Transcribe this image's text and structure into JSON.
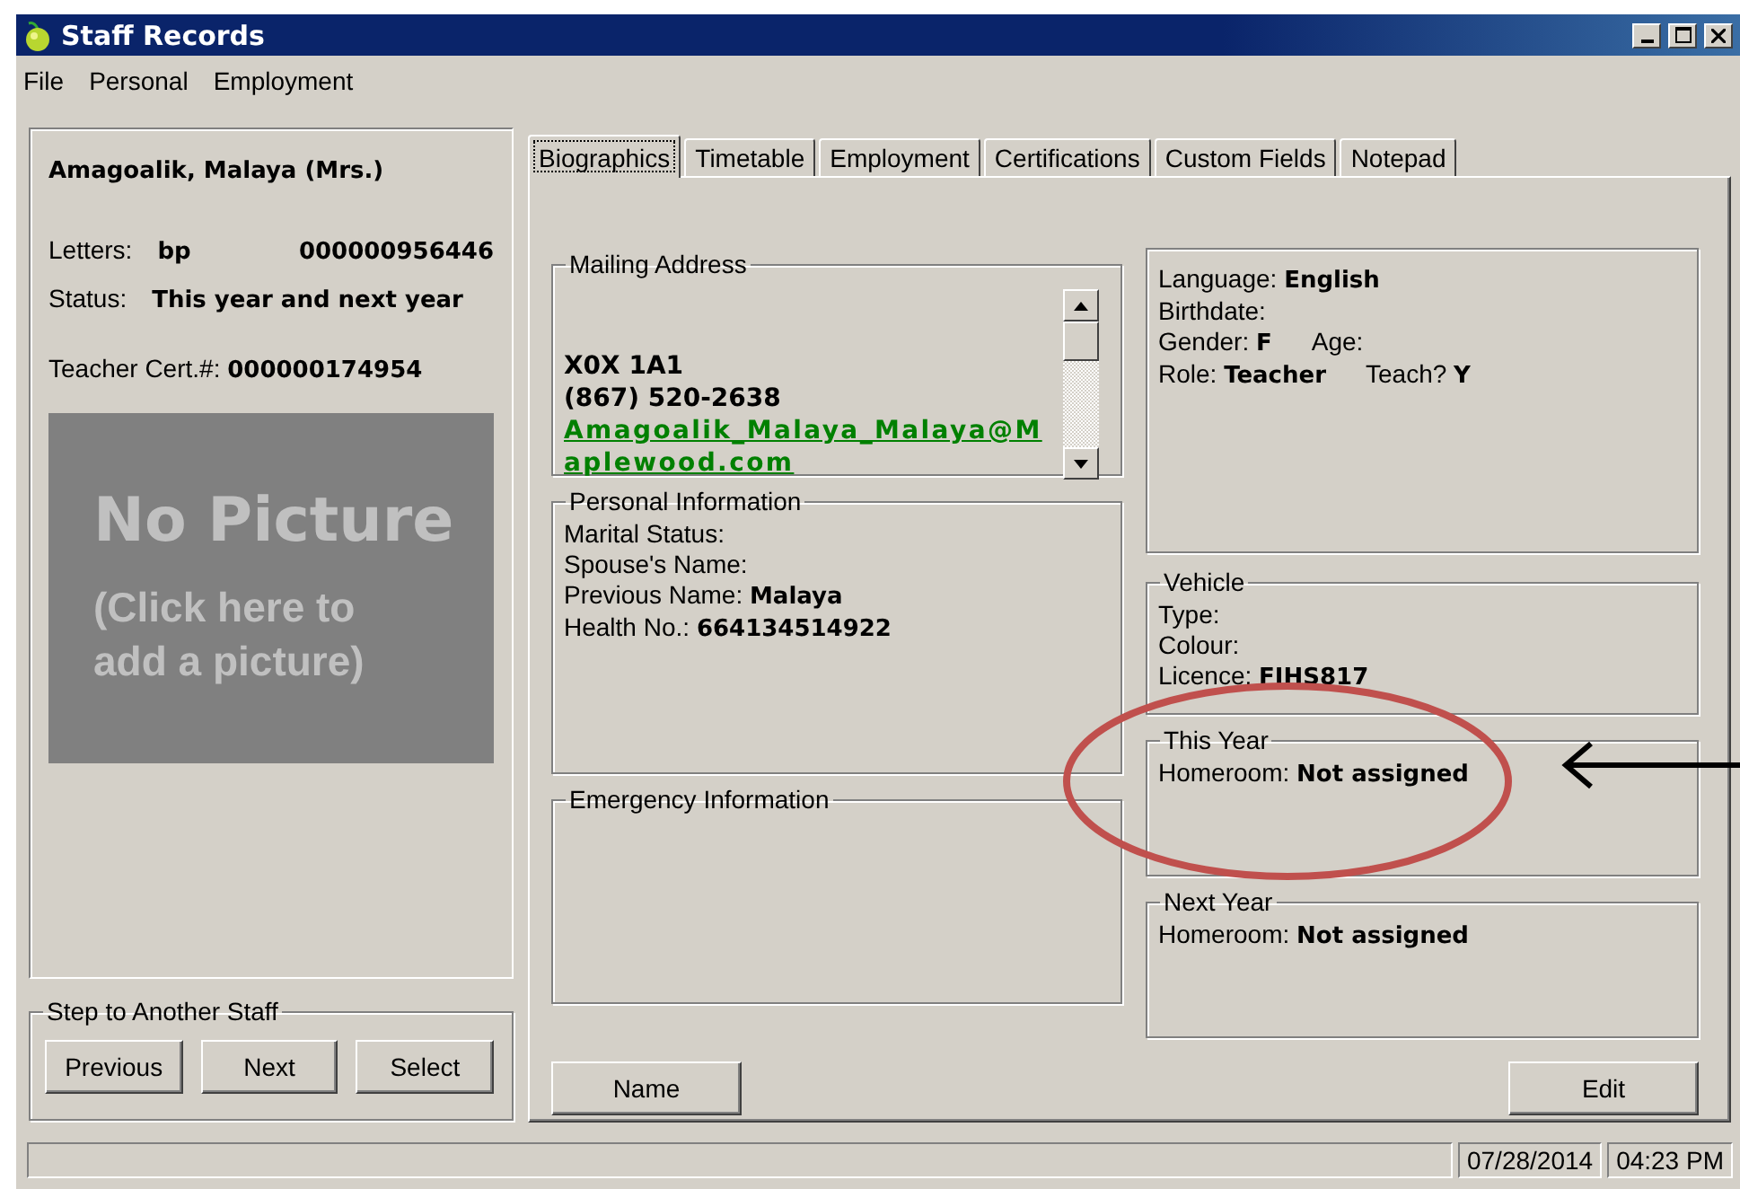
{
  "window": {
    "title": "Staff Records"
  },
  "menu": [
    "File",
    "Personal",
    "Employment"
  ],
  "staff": {
    "name": "Amagoalik, Malaya (Mrs.)",
    "letters": {
      "label": "Letters:",
      "value": "bp",
      "number": "000000956446"
    },
    "status": {
      "label": "Status:",
      "value": "This year and next year"
    },
    "cert": "Teacher Cert.#: **000000174954**",
    "photo": {
      "title": "No Picture",
      "hint": "(Click here to add a picture)"
    }
  },
  "navigator": {
    "title": "Step to Another Staff",
    "buttons": [
      "Previous",
      "Next",
      "Select"
    ]
  },
  "tabs": [
    {
      "label": "Biographics",
      "selected": true
    },
    {
      "label": "Timetable",
      "selected": false
    },
    {
      "label": "Employment",
      "selected": false
    },
    {
      "label": "Certifications",
      "selected": false
    },
    {
      "label": "Custom Fields",
      "selected": false
    },
    {
      "label": "Notepad",
      "selected": false
    }
  ],
  "mailing_address": {
    "title": "Mailing Address",
    "lines": [
      "X0X 1A1",
      "(867) 520-2638"
    ],
    "email": "Amagoalik_Malaya_Malaya@Maplewood.com"
  },
  "profile": {
    "rows": [
      [
        "Language: **English**"
      ],
      [
        "Birthdate:"
      ],
      [
        "Gender: **F**",
        "Age:"
      ],
      [
        "Role: **Teacher**",
        "Teach? **Y**"
      ]
    ]
  },
  "personal_information": {
    "title": "Personal Information",
    "rows": [
      "Marital Status:",
      "Spouse's Name:",
      "Previous Name: **Malaya**",
      "Health No.: **664134514922**"
    ]
  },
  "emergency_information": {
    "title": "Emergency Information"
  },
  "vehicle": {
    "title": "Vehicle",
    "rows": [
      "Type:",
      "Colour:",
      "Licence: **FIHS817**"
    ]
  },
  "this_year": {
    "title": "This Year",
    "rows": [
      "Homeroom: **Not assigned**"
    ]
  },
  "next_year": {
    "title": "Next Year",
    "rows": [
      "Homeroom: **Not assigned**"
    ]
  },
  "buttons": {
    "name": "Name",
    "edit": "Edit"
  },
  "status_bar": {
    "date": "07/28/2014",
    "time": "04:23 PM"
  }
}
